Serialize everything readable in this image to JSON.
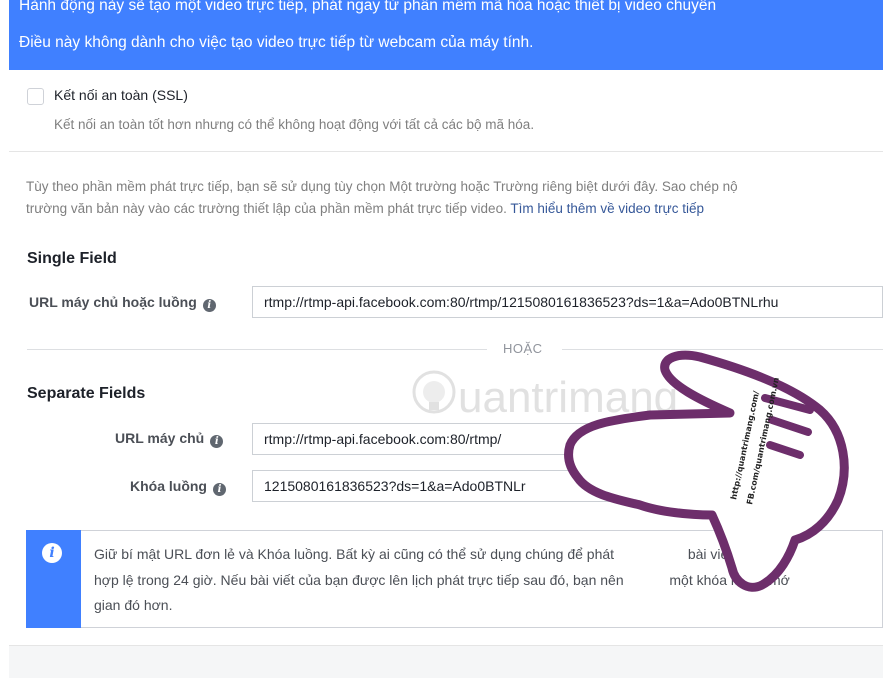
{
  "banner": {
    "line1": "Hành động này sẽ tạo một video trực tiếp, phát ngay từ phần mềm mã hóa hoặc thiết bị video chuyên",
    "line2": "Điều này không dành cho việc tạo video trực tiếp từ webcam của máy tính."
  },
  "ssl": {
    "label": "Kết nối an toàn (SSL)",
    "description": "Kết nối an toàn tốt hơn nhưng có thể không hoạt động với tất cả các bộ mã hóa.",
    "checked": false
  },
  "intro": {
    "line1": "Tùy theo phần mềm phát trực tiếp, bạn sẽ sử dụng tùy chọn Một trường hoặc Trường riêng biệt dưới đây. Sao chép nộ",
    "line2": "trường văn bản này vào các trường thiết lập của phần mềm phát trực tiếp video.",
    "link": "Tìm hiểu thêm về video trực tiếp"
  },
  "single_field": {
    "title": "Single Field",
    "label": "URL máy chủ hoặc luồng",
    "value": "rtmp://rtmp-api.facebook.com:80/rtmp/1215080161836523?ds=1&a=Ado0BTNLrhu"
  },
  "or_text": "HOẶC",
  "separate_fields": {
    "title": "Separate Fields",
    "server_label": "URL máy chủ",
    "server_value": "rtmp://rtmp-api.facebook.com:80/rtmp/",
    "key_label": "Khóa luồng",
    "key_value": "1215080161836523?ds=1&a=Ado0BTNLr"
  },
  "notice": {
    "icon": "info-icon",
    "line1": "Giữ bí mật URL đơn lẻ và Khóa luồng. Bất kỳ ai cũng có thể sử dụng chúng để phát",
    "line1b": "bài viết của bạ",
    "line2": "hợp lệ trong 24 giờ. Nếu bài viết của bạn được lên lịch phát trực tiếp sau đó, bạn nên",
    "line2b": "một khóa luồng mớ",
    "line3": "gian đó hơn."
  },
  "watermark": {
    "brand": "uantrimang",
    "url1": "http://quantrimang.com/",
    "url2": "FB.com/quantrimang.com.vn"
  },
  "colors": {
    "accent": "#4080ff",
    "link": "#365899",
    "muted": "#7f7f7f"
  }
}
